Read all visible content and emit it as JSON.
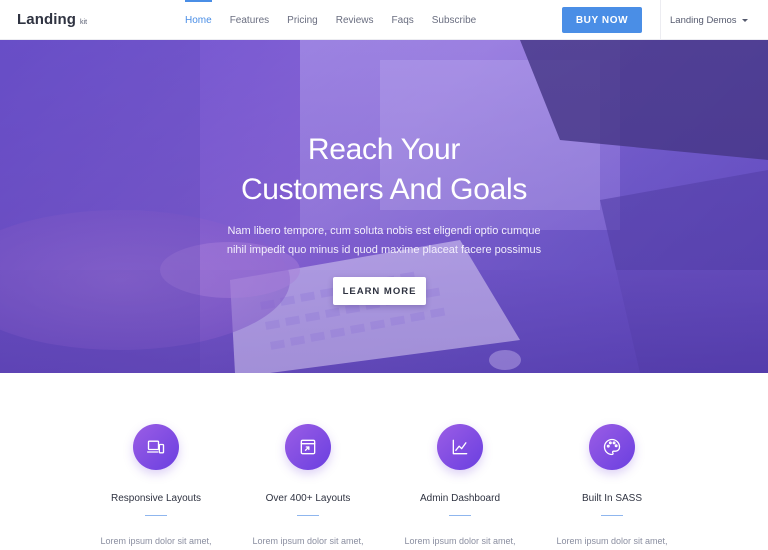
{
  "brand": {
    "name": "Landing",
    "kit": "kit"
  },
  "nav": {
    "links": [
      "Home",
      "Features",
      "Pricing",
      "Reviews",
      "Faqs",
      "Subscribe"
    ],
    "active": "Home",
    "buy_label": "BUY NOW",
    "demos_label": "Landing Demos"
  },
  "hero": {
    "title_line1": "Reach Your",
    "title_line2": "Customers And Goals",
    "subtitle_line1": "Nam libero tempore, cum soluta nobis est eligendi optio cumque",
    "subtitle_line2": "nihil impedit quo minus id quod maxime placeat facere possimus",
    "button_label": "LEARN MORE"
  },
  "features": [
    {
      "icon": "devices-icon",
      "title": "Responsive Layouts",
      "text": "Lorem ipsum dolor sit amet,"
    },
    {
      "icon": "layouts-icon",
      "title": "Over 400+ Layouts",
      "text": "Lorem ipsum dolor sit amet,"
    },
    {
      "icon": "chart-icon",
      "title": "Admin Dashboard",
      "text": "Lorem ipsum dolor sit amet,"
    },
    {
      "icon": "palette-icon",
      "title": "Built In SASS",
      "text": "Lorem ipsum dolor sit amet,"
    }
  ],
  "colors": {
    "accent": "#4a8ee6",
    "hero_purple": "#7b5ad0",
    "icon_gradient_start": "#9b5de5",
    "icon_gradient_end": "#6a3fe0"
  }
}
